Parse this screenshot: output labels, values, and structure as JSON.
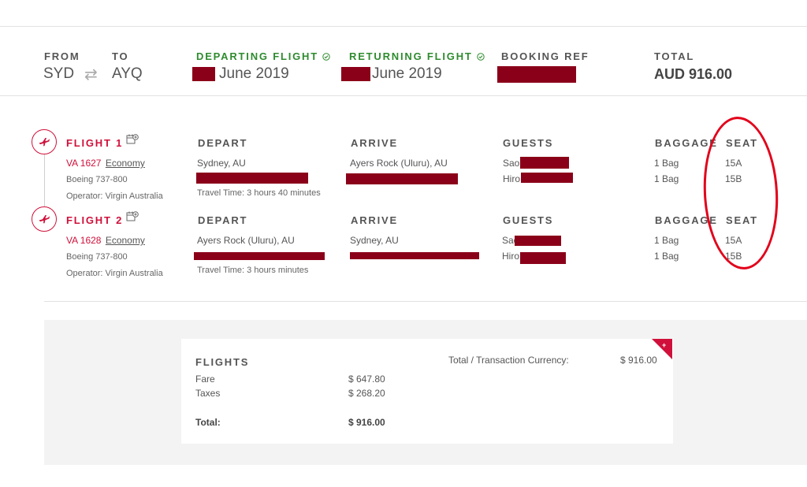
{
  "header": {
    "from_label": "FROM",
    "to_label": "TO",
    "from_code": "SYD",
    "to_code": "AYQ",
    "swap_symbol": "⇄",
    "departing_label": "DEPARTING FLIGHT",
    "departing_date": "June 2019",
    "returning_label": "RETURNING FLIGHT",
    "returning_date": "June 2019",
    "booking_ref_label": "BOOKING REF",
    "total_label": "TOTAL",
    "total_value": "AUD 916.00"
  },
  "columns": {
    "depart": "DEPART",
    "arrive": "ARRIVE",
    "guests": "GUESTS",
    "baggage": "BAGGAGE",
    "seat": "SEAT"
  },
  "flights": [
    {
      "title": "FLIGHT 1",
      "number": "VA 1627",
      "cabin": "Economy",
      "aircraft": "Boeing 737-800",
      "operator": "Operator: Virgin Australia",
      "depart_city": "Sydney, AU",
      "arrive_city": "Ayers Rock (Uluru), AU",
      "travel_time": "Travel Time: 3 hours 40 minutes",
      "guests": [
        "Sao",
        "Hiro"
      ],
      "baggage": [
        "1 Bag",
        "1 Bag"
      ],
      "seats": [
        "15A",
        "15B"
      ]
    },
    {
      "title": "FLIGHT 2",
      "number": "VA 1628",
      "cabin": "Economy",
      "aircraft": "Boeing 737-800",
      "operator": "Operator: Virgin Australia",
      "depart_city": "Ayers Rock (Uluru), AU",
      "arrive_city": "Sydney, AU",
      "travel_time": "Travel Time: 3 hours minutes",
      "guests": [
        "Sao",
        "Hiro"
      ],
      "baggage": [
        "1 Bag",
        "1 Bag"
      ],
      "seats": [
        "15A",
        "15B"
      ]
    }
  ],
  "summary": {
    "flights_label": "FLIGHTS",
    "fare_label": "Fare",
    "fare_value": "$ 647.80",
    "taxes_label": "Taxes",
    "taxes_value": "$ 268.20",
    "total_label": "Total:",
    "total_value": "$ 916.00",
    "currency_label": "Total / Transaction Currency:",
    "currency_value": "$ 916.00",
    "ribbon_symbol": "+"
  },
  "colors": {
    "brand_red": "#d0103a",
    "redaction": "#8b0019",
    "confirm_green": "#2e8b2e",
    "annotation_red": "#e2001a"
  },
  "icons": {
    "check": "check-circle-icon",
    "plane": "plane-icon",
    "calendar_add": "calendar-add-icon"
  }
}
